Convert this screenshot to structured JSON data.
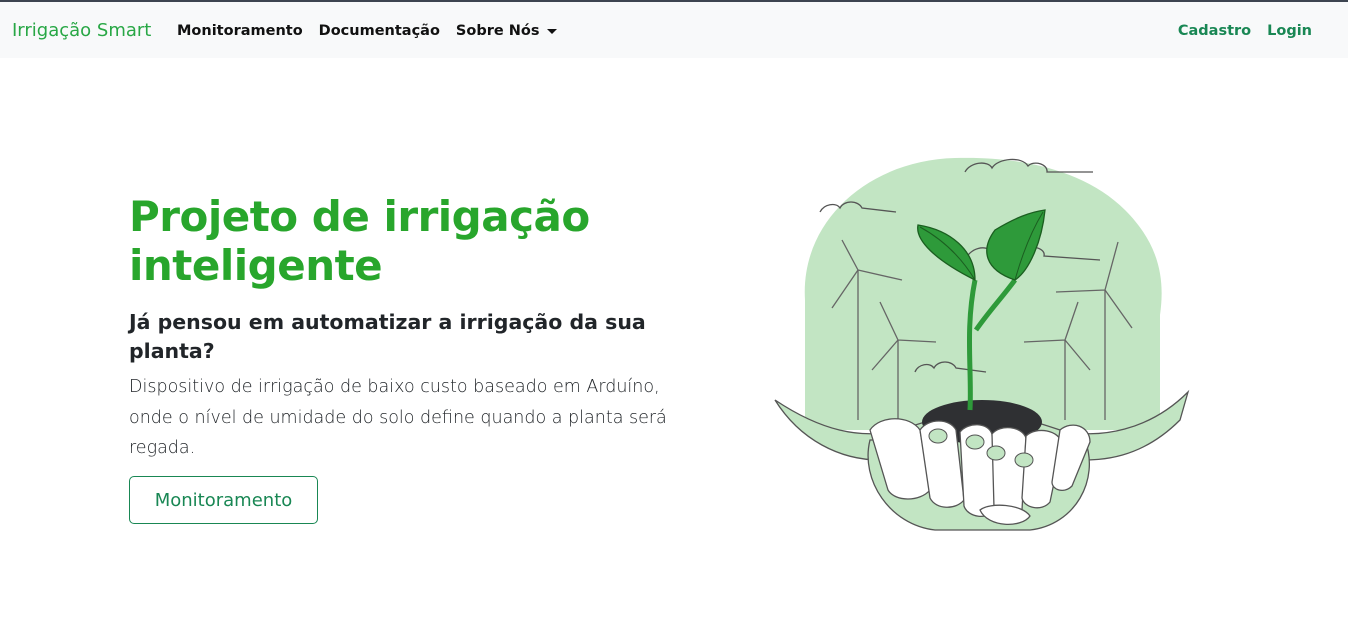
{
  "navbar": {
    "brand": "Irrigação Smart",
    "links": [
      {
        "label": "Monitoramento"
      },
      {
        "label": "Documentação"
      },
      {
        "label": "Sobre Nós"
      }
    ],
    "right_links": [
      {
        "label": "Cadastro"
      },
      {
        "label": "Login"
      }
    ]
  },
  "hero": {
    "title_line1": "Projeto de irrigação",
    "title_line2": "inteligente",
    "subtitle": "Já pensou em automatizar a irrigação da sua planta?",
    "description": "Dispositivo de irrigação de baixo custo baseado em Arduíno, onde o nível de umidade do solo define quando a planta será regada.",
    "button_label": "Monitoramento"
  },
  "colors": {
    "brand_green": "#28a745",
    "link_green": "#198754",
    "illustration_light_green": "#c2e5c3",
    "leaf_green": "#2e9a3a"
  },
  "illustration": {
    "icon": "plant-in-hands-illustration"
  }
}
